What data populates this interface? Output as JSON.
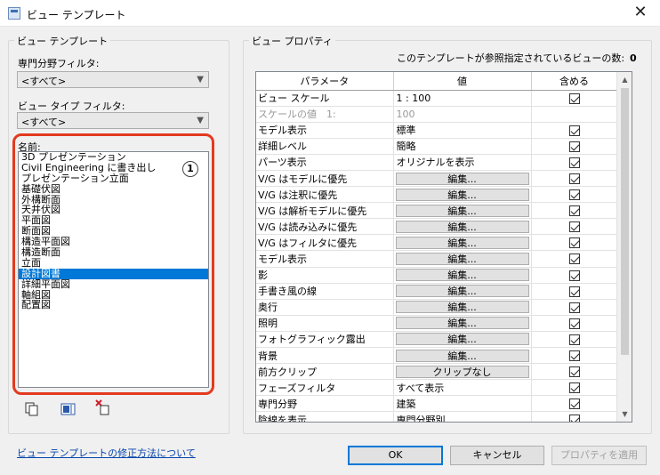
{
  "window": {
    "title": "ビュー テンプレート",
    "close_glyph": "✕"
  },
  "left_group": {
    "legend": "ビュー テンプレート",
    "discipline_filter_label": "専門分野フィルタ:",
    "discipline_filter_value": "<すべて>",
    "view_type_filter_label": "ビュー タイプ フィルタ:",
    "view_type_filter_value": "<すべて>",
    "names_label": "名前:",
    "annotation_badge": "1",
    "names": [
      "3D プレゼンテーション",
      "Civil Engineering に書き出し",
      "プレゼンテーション立面",
      "基礎伏図",
      "外構断面",
      "天井伏図",
      "平面図",
      "断面図",
      "構造平面図",
      "構造断面",
      "立面",
      "設計図書",
      "詳細平面図",
      "軸組図",
      "配置図"
    ],
    "selected_name": "設計図書"
  },
  "toolbar_icons": [
    "duplicate-icon",
    "rename-icon",
    "delete-icon"
  ],
  "help_link": "ビュー テンプレートの修正方法について",
  "right_group": {
    "legend": "ビュー プロパティ",
    "ref_count_label": "このテンプレートが参照指定されているビューの数:",
    "ref_count_value": "0",
    "columns": [
      "パラメータ",
      "値",
      "含める"
    ],
    "rows": [
      {
        "param": "ビュー スケール",
        "value": "1 : 100",
        "type": "text",
        "include": "checked"
      },
      {
        "param": "スケールの値　1:",
        "value": "100",
        "type": "text",
        "include": "none",
        "dim": true
      },
      {
        "param": "モデル表示",
        "value": "標準",
        "type": "text",
        "include": "checked"
      },
      {
        "param": "詳細レベル",
        "value": "簡略",
        "type": "text",
        "include": "checked"
      },
      {
        "param": "パーツ表示",
        "value": "オリジナルを表示",
        "type": "text",
        "include": "checked"
      },
      {
        "param": "V/G はモデルに優先",
        "value": "編集...",
        "type": "button",
        "include": "checked"
      },
      {
        "param": "V/G は注釈に優先",
        "value": "編集...",
        "type": "button",
        "include": "checked"
      },
      {
        "param": "V/G は解析モデルに優先",
        "value": "編集...",
        "type": "button",
        "include": "checked"
      },
      {
        "param": "V/G は読み込みに優先",
        "value": "編集...",
        "type": "button",
        "include": "checked"
      },
      {
        "param": "V/G はフィルタに優先",
        "value": "編集...",
        "type": "button",
        "include": "checked"
      },
      {
        "param": "モデル表示",
        "value": "編集...",
        "type": "button",
        "include": "checked"
      },
      {
        "param": "影",
        "value": "編集...",
        "type": "button",
        "include": "checked"
      },
      {
        "param": "手書き風の線",
        "value": "編集...",
        "type": "button",
        "include": "checked"
      },
      {
        "param": "奥行",
        "value": "編集...",
        "type": "button",
        "include": "checked"
      },
      {
        "param": "照明",
        "value": "編集...",
        "type": "button",
        "include": "checked"
      },
      {
        "param": "フォトグラフィック露出",
        "value": "編集...",
        "type": "button",
        "include": "checked"
      },
      {
        "param": "背景",
        "value": "編集...",
        "type": "button",
        "include": "checked"
      },
      {
        "param": "前方クリップ",
        "value": "クリップなし",
        "type": "button",
        "include": "checked"
      },
      {
        "param": "フェーズフィルタ",
        "value": "すべて表示",
        "type": "text",
        "include": "checked"
      },
      {
        "param": "専門分野",
        "value": "建築",
        "type": "text",
        "include": "checked"
      },
      {
        "param": "陰線を表示",
        "value": "専門分野別",
        "type": "text",
        "include": "checked"
      }
    ]
  },
  "buttons": {
    "ok": "OK",
    "cancel": "キャンセル",
    "apply": "プロパティを適用"
  },
  "colors": {
    "selection": "#0078d7",
    "annotation_outline": "#e33a1f",
    "link": "#0645ad"
  }
}
